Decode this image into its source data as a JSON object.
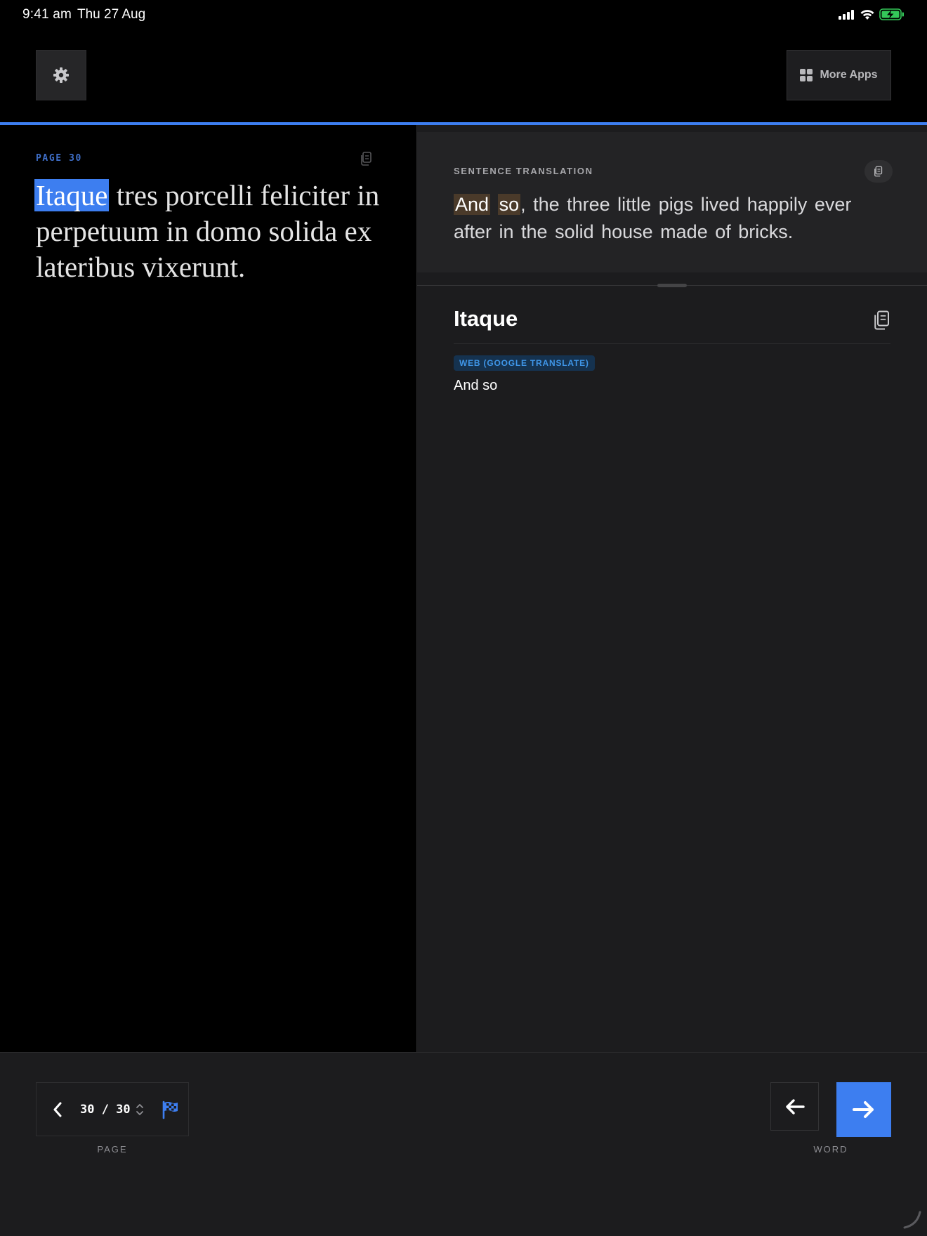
{
  "status_bar": {
    "time": "9:41 am",
    "date": "Thu 27 Aug",
    "icons": [
      "signal-icon",
      "wifi-icon",
      "battery-charging-icon"
    ]
  },
  "toolbar": {
    "settings_icon": "gear-icon",
    "more_apps_label": "More Apps",
    "more_apps_icon": "grid-icon",
    "accent_color": "#3d7ef0"
  },
  "source": {
    "page_label": "PAGE 30",
    "selected_word": "Itaque",
    "rest_text": "tres porcelli feliciter in perpetuum in domo solida ex lateribus vixerunt."
  },
  "sentence": {
    "label": "SENTENCE TRANSLATION",
    "highlight_1": "And",
    "highlight_2": "so",
    "rest_text": ", the three little pigs lived happily ever after in the solid house made of bricks."
  },
  "word": {
    "title": "Itaque",
    "source_badge": "WEB (GOOGLE TRANSLATE)",
    "meaning": "And so"
  },
  "bottom": {
    "page_count": "30 / 30",
    "page_caption": "PAGE",
    "word_caption": "WORD"
  }
}
